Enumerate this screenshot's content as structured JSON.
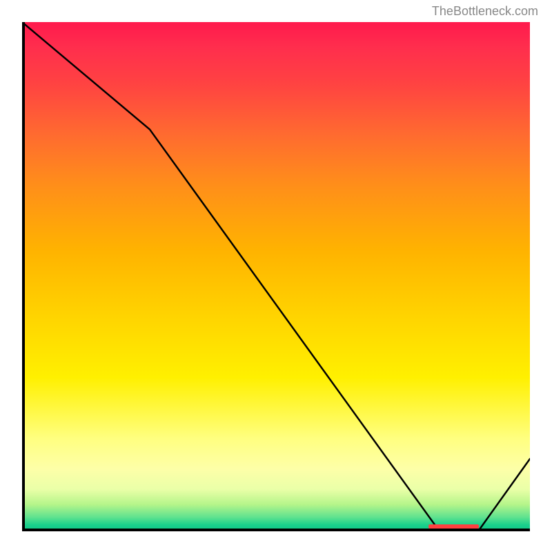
{
  "watermark": "TheBottleneck.com",
  "chart_data": {
    "type": "line",
    "title": "",
    "xlabel": "",
    "ylabel": "",
    "xlim": [
      0,
      100
    ],
    "ylim": [
      0,
      100
    ],
    "x": [
      0,
      25,
      82,
      90,
      100
    ],
    "values": [
      100,
      79,
      0,
      0,
      14
    ],
    "marker_range_x": [
      80,
      90
    ],
    "background_gradient": {
      "top": "#ff1a4d",
      "mid": "#ffd400",
      "bottom": "#12c989"
    }
  }
}
